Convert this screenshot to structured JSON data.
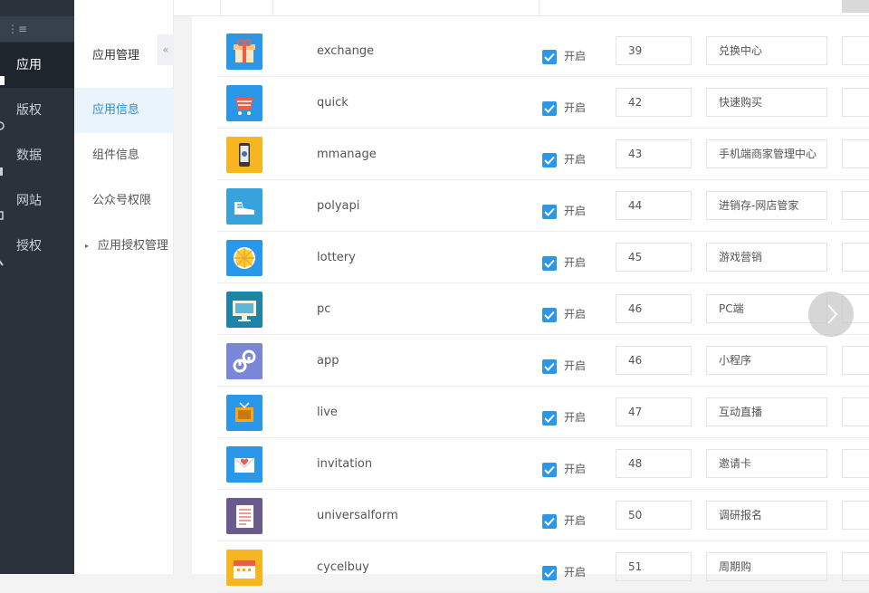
{
  "sidebar": {
    "items": [
      {
        "label": "应用",
        "icon": "grid-icon",
        "active": true
      },
      {
        "label": "版权",
        "icon": "copyright-icon",
        "active": false
      },
      {
        "label": "数据",
        "icon": "data-icon",
        "active": false
      },
      {
        "label": "网站",
        "icon": "monitor-icon",
        "active": false
      },
      {
        "label": "授权",
        "icon": "key-icon",
        "active": false
      }
    ]
  },
  "submenu": {
    "title": "应用管理",
    "collapse_glyph": "«",
    "items": [
      {
        "label": "应用信息",
        "active": true
      },
      {
        "label": "组件信息",
        "active": false
      },
      {
        "label": "公众号权限",
        "active": false
      },
      {
        "label": "应用授权管理",
        "active": false,
        "caret": "▸"
      }
    ]
  },
  "apps": [
    {
      "name": "exchange",
      "enabled_label": "开启",
      "order": "39",
      "title": "兑换中心",
      "icon": "gift-icon",
      "icon_bg": "#2b97e8"
    },
    {
      "name": "quick",
      "enabled_label": "开启",
      "order": "42",
      "title": "快速购买",
      "icon": "cart-icon",
      "icon_bg": "#2b97e8"
    },
    {
      "name": "mmanage",
      "enabled_label": "开启",
      "order": "43",
      "title": "手机端商家管理中心",
      "icon": "phone-icon",
      "icon_bg": "#f6b521"
    },
    {
      "name": "polyapi",
      "enabled_label": "开启",
      "order": "44",
      "title": "进销存-网店管家",
      "icon": "shoe-icon",
      "icon_bg": "#36a3dc"
    },
    {
      "name": "lottery",
      "enabled_label": "开启",
      "order": "45",
      "title": "游戏营销",
      "icon": "wheel-icon",
      "icon_bg": "#2b97e8"
    },
    {
      "name": "pc",
      "enabled_label": "开启",
      "order": "46",
      "title": "PC端",
      "icon": "pc-icon",
      "icon_bg": "#1c84a8"
    },
    {
      "name": "app",
      "enabled_label": "开启",
      "order": "46",
      "title": "小程序",
      "icon": "miniapp-icon",
      "icon_bg": "#7a86d6"
    },
    {
      "name": "live",
      "enabled_label": "开启",
      "order": "47",
      "title": "互动直播",
      "icon": "tv-icon",
      "icon_bg": "#2b97e8"
    },
    {
      "name": "invitation",
      "enabled_label": "开启",
      "order": "48",
      "title": "邀请卡",
      "icon": "envelope-icon",
      "icon_bg": "#2b97e8"
    },
    {
      "name": "universalform",
      "enabled_label": "开启",
      "order": "50",
      "title": "调研报名",
      "icon": "form-icon",
      "icon_bg": "#6b5a8e"
    },
    {
      "name": "cycelbuy",
      "enabled_label": "开启",
      "order": "51",
      "title": "周期购",
      "icon": "calendar-icon",
      "icon_bg": "#f6b521"
    }
  ]
}
